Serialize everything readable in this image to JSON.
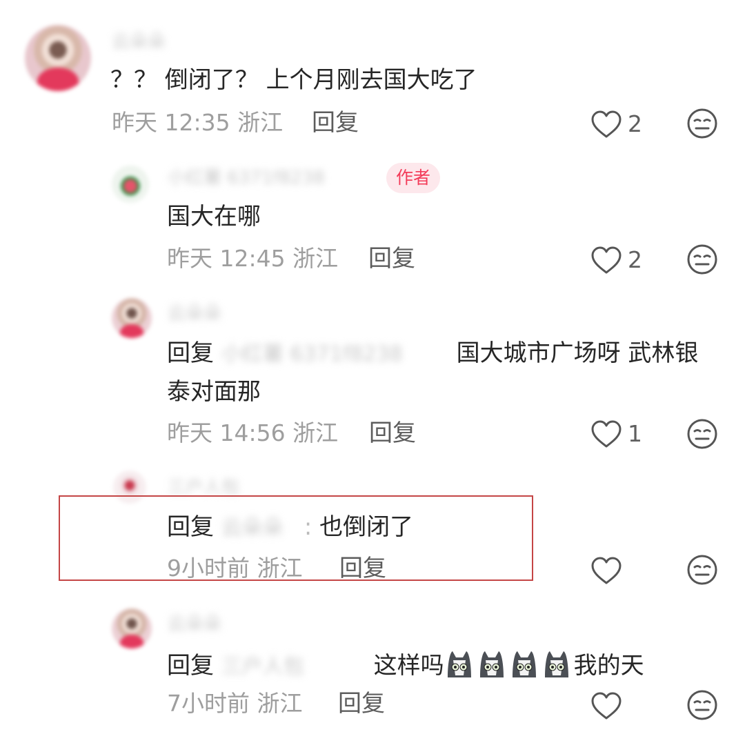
{
  "comments": [
    {
      "username": "云朵朵",
      "text": "？？ 倒闭了？ 上个月刚去国大吃了",
      "time": "昨天 12:35",
      "location": "浙江",
      "reply_label": "回复",
      "likes": "2"
    },
    {
      "username": "小红薯 6371f8238",
      "badge": "作者",
      "text": "国大在哪",
      "time": "昨天 12:45",
      "location": "浙江",
      "reply_label": "回复",
      "likes": "2"
    },
    {
      "username": "云朵朵",
      "reply_prefix": "回复",
      "reply_to": "小红薯 6371f8238",
      "text_line1": "国大城市广场呀 武林银",
      "text_line2": "泰对面那",
      "time": "昨天 14:56",
      "location": "浙江",
      "reply_label": "回复",
      "likes": "1"
    },
    {
      "username": "三户人包",
      "reply_prefix": "回复",
      "reply_to": "云朵朵",
      "separator": ":",
      "text": "也倒闭了",
      "time": "9小时前",
      "location": "浙江",
      "reply_label": "回复",
      "likes": ""
    },
    {
      "username": "云朵朵",
      "reply_prefix": "回复",
      "reply_to": "三户人包",
      "text_before": "这样吗",
      "emoji": [
        "cat-icon",
        "cat-icon",
        "cat-icon",
        "cat-icon"
      ],
      "text_after": "我的天",
      "time": "7小时前",
      "location": "浙江",
      "reply_label": "回复",
      "likes": ""
    }
  ],
  "colors": {
    "author_badge_bg": "#fde8ec",
    "author_badge_text": "#f33b59",
    "highlight_box": "#c44545"
  }
}
